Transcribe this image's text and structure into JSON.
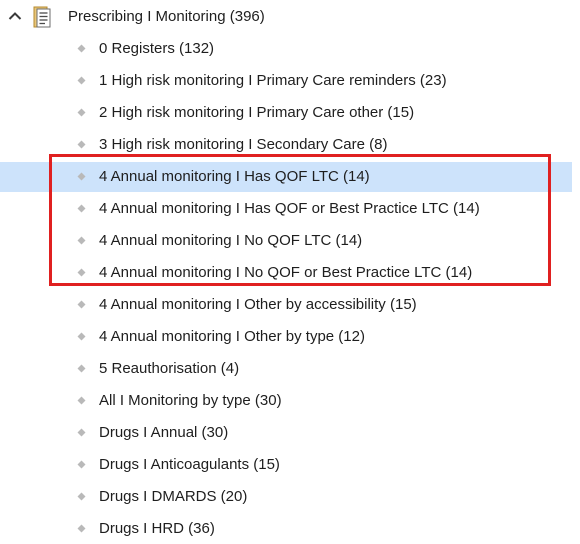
{
  "tree": {
    "root": {
      "label": "Prescribing I Monitoring (396)",
      "expand_icon": "chevron-up-icon",
      "icon": "folder-document-icon"
    },
    "selected_index": 4,
    "highlighted_range": [
      4,
      7
    ],
    "highlight_color": "#e02020",
    "selection_color": "#cde3fb",
    "bullet_icon": "diamond-bullet-icon",
    "items": [
      {
        "label": "0 Registers (132)"
      },
      {
        "label": "1 High risk monitoring I Primary Care reminders (23)"
      },
      {
        "label": "2 High risk monitoring I Primary Care other (15)"
      },
      {
        "label": "3 High risk monitoring I Secondary Care (8)"
      },
      {
        "label": "4 Annual monitoring I Has QOF LTC (14)"
      },
      {
        "label": "4 Annual monitoring I Has QOF or Best Practice LTC (14)"
      },
      {
        "label": "4 Annual monitoring I No QOF LTC (14)"
      },
      {
        "label": "4 Annual monitoring I No QOF or Best Practice LTC (14)"
      },
      {
        "label": "4 Annual monitoring I Other by accessibility (15)"
      },
      {
        "label": "4 Annual monitoring I Other by type (12)"
      },
      {
        "label": "5 Reauthorisation (4)"
      },
      {
        "label": "All I Monitoring by type (30)"
      },
      {
        "label": "Drugs I Annual (30)"
      },
      {
        "label": "Drugs I Anticoagulants (15)"
      },
      {
        "label": "Drugs I DMARDS (20)"
      },
      {
        "label": "Drugs I HRD (36)"
      }
    ]
  }
}
